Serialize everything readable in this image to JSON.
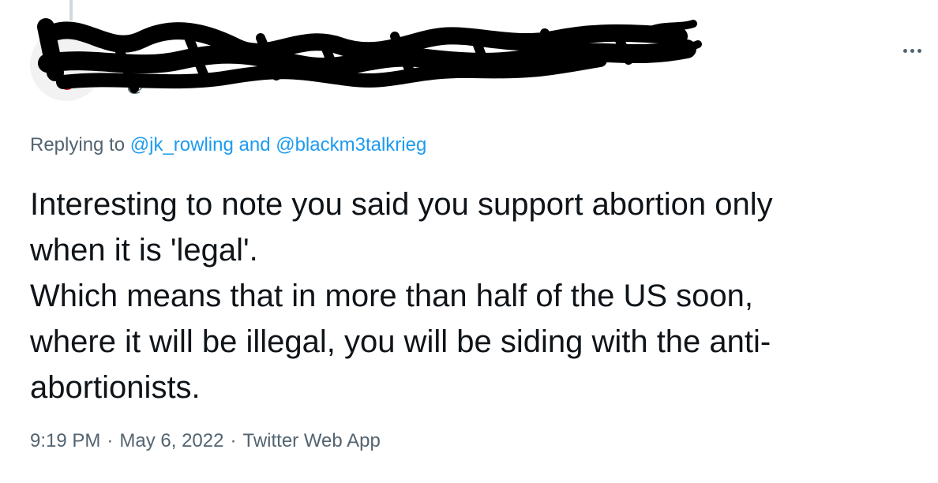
{
  "header": {
    "display_name": "",
    "handle": "@"
  },
  "reply_context": {
    "prefix": "Replying to",
    "mention_1": "@jk_rowling",
    "conjunction": "and",
    "mention_2": "@blackm3talkrieg"
  },
  "tweet": {
    "lines": [
      "Interesting to note you said you support abortion only",
      "when it is 'legal'.",
      "Which means that in more than half of the US soon,",
      "where it will be illegal, you will be siding with the anti-",
      "abortionists."
    ]
  },
  "meta": {
    "time": "9:19 PM",
    "separator": "·",
    "date": "May 6, 2022",
    "source": "Twitter Web App"
  },
  "icons": {
    "more": "more-horizontal-icon"
  },
  "colors": {
    "link": "#1d9bf0",
    "secondary_text": "#536471",
    "primary_text": "#0f1419",
    "redaction": "#000000"
  }
}
